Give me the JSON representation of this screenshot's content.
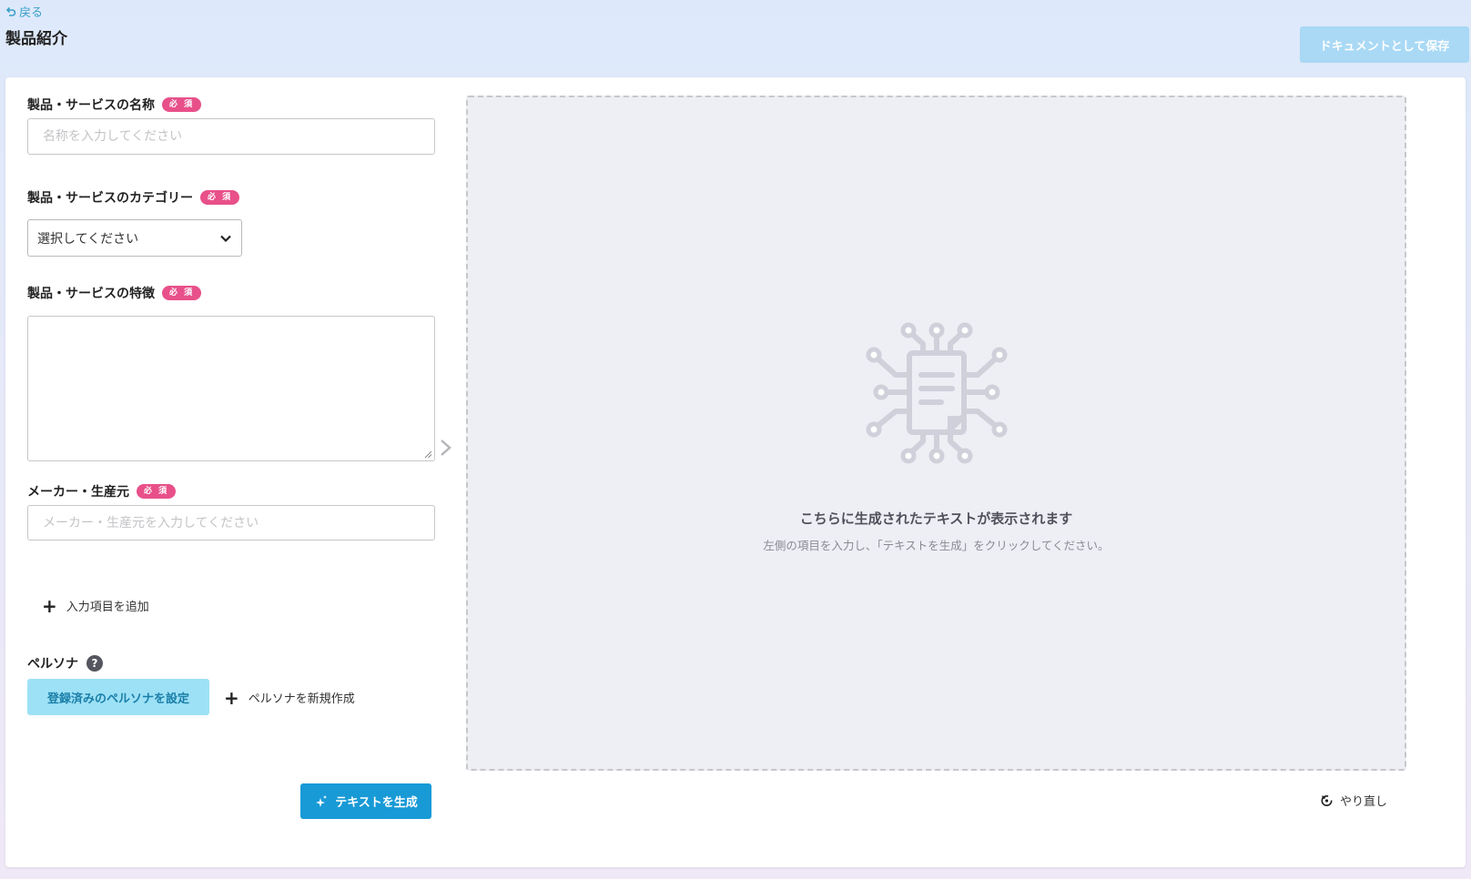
{
  "header": {
    "back_label": "戻る",
    "title": "製品紹介",
    "save_button": "ドキュメントとして保存"
  },
  "form": {
    "required_badge": "必 須",
    "name": {
      "label": "製品・サービスの名称",
      "placeholder": "名称を入力してください",
      "value": ""
    },
    "category": {
      "label": "製品・サービスのカテゴリー",
      "selected": "選択してください"
    },
    "features": {
      "label": "製品・サービスの特徴",
      "value": ""
    },
    "maker": {
      "label": "メーカー・生産元",
      "placeholder": "メーカー・生産元を入力してください",
      "value": ""
    },
    "add_field": "入力項目を追加",
    "persona": {
      "label": "ペルソナ",
      "help": "?",
      "set_button": "登録済みのペルソナを設定",
      "new_link": "ペルソナを新規作成"
    },
    "generate_button": "テキストを生成"
  },
  "output": {
    "title": "こちらに生成されたテキストが表示されます",
    "subtitle": "左側の項目を入力し、「テキストを生成」をクリックしてください。",
    "redo": "やり直し"
  },
  "colors": {
    "accent": "#189ad6",
    "required": "#e8508a",
    "persona_button": "#9de1f6",
    "save_disabled": "#a9d9f5"
  }
}
